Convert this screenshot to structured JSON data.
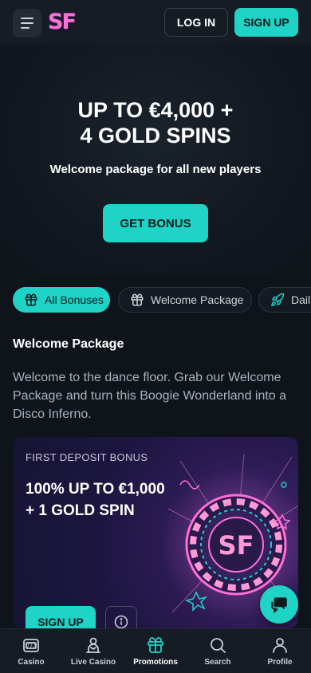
{
  "header": {
    "logo_text": "SF",
    "login_label": "LOG IN",
    "signup_label": "SIGN UP"
  },
  "hero": {
    "title_line1": "UP TO €4,000 +",
    "title_line2": "4 GOLD SPINS",
    "subtitle": "Welcome package for all new players",
    "cta_label": "GET BONUS"
  },
  "filters": [
    {
      "label": "All Bonuses",
      "icon": "gift-box-icon",
      "active": true
    },
    {
      "label": "Welcome Package",
      "icon": "gift-icon",
      "active": false
    },
    {
      "label": "Dail",
      "icon": "rocket-icon",
      "active": false
    }
  ],
  "section": {
    "title": "Welcome Package",
    "description": "Welcome to the dance floor. Grab our Welcome Package and turn this Boogie Wonderland into a Disco Inferno."
  },
  "promo_card": {
    "label": "FIRST DEPOSIT BONUS",
    "title_line1": "100% UP TO €1,000",
    "title_line2": "+ 1 GOLD SPIN",
    "signup_label": "SIGN UP",
    "chip_logo": "SF"
  },
  "bottom_nav": [
    {
      "label": "Casino",
      "icon": "slot-machine-icon"
    },
    {
      "label": "Live Casino",
      "icon": "dealer-icon"
    },
    {
      "label": "Promotions",
      "icon": "gift-icon",
      "active": true
    },
    {
      "label": "Search",
      "icon": "search-icon"
    },
    {
      "label": "Profile",
      "icon": "user-icon"
    }
  ],
  "colors": {
    "accent": "#1fd3c6",
    "background": "#0f141b",
    "logo": "#ff6fd8"
  }
}
